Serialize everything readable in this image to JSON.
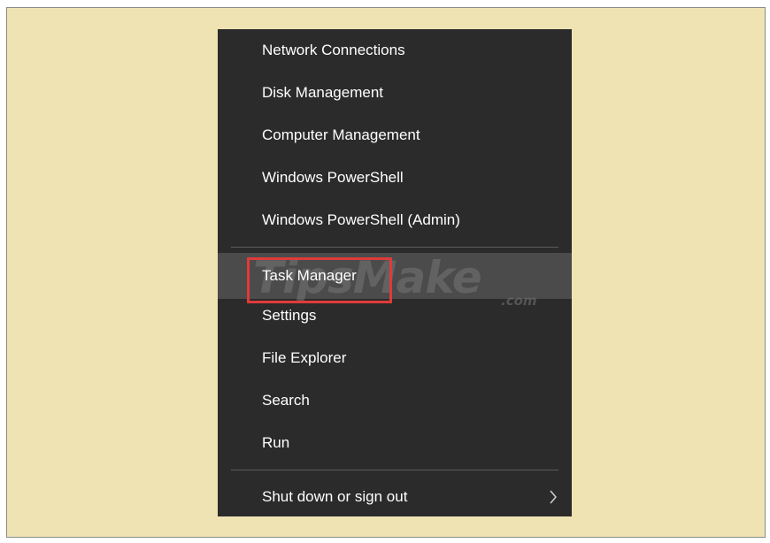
{
  "menu": {
    "items": [
      {
        "label": "Network Connections",
        "highlighted": false,
        "submenu": false
      },
      {
        "label": "Disk Management",
        "highlighted": false,
        "submenu": false
      },
      {
        "label": "Computer Management",
        "highlighted": false,
        "submenu": false
      },
      {
        "label": "Windows PowerShell",
        "highlighted": false,
        "submenu": false
      },
      {
        "label": "Windows PowerShell (Admin)",
        "highlighted": false,
        "submenu": false
      },
      {
        "label": "Task Manager",
        "highlighted": true,
        "submenu": false
      },
      {
        "label": "Settings",
        "highlighted": false,
        "submenu": false
      },
      {
        "label": "File Explorer",
        "highlighted": false,
        "submenu": false
      },
      {
        "label": "Search",
        "highlighted": false,
        "submenu": false
      },
      {
        "label": "Run",
        "highlighted": false,
        "submenu": false
      },
      {
        "label": "Shut down or sign out",
        "highlighted": false,
        "submenu": true,
        "submenu_icon": "chevron-right-icon"
      }
    ]
  },
  "watermark": {
    "main": "TipsMake",
    "sub": ".com"
  },
  "colors": {
    "page_background": "#efe3b3",
    "menu_background": "#2b2b2b",
    "menu_text": "#ffffff",
    "highlight_background": "#4b4b4b",
    "separator": "#5c5c5c",
    "annotation_border": "#e03a3a"
  }
}
